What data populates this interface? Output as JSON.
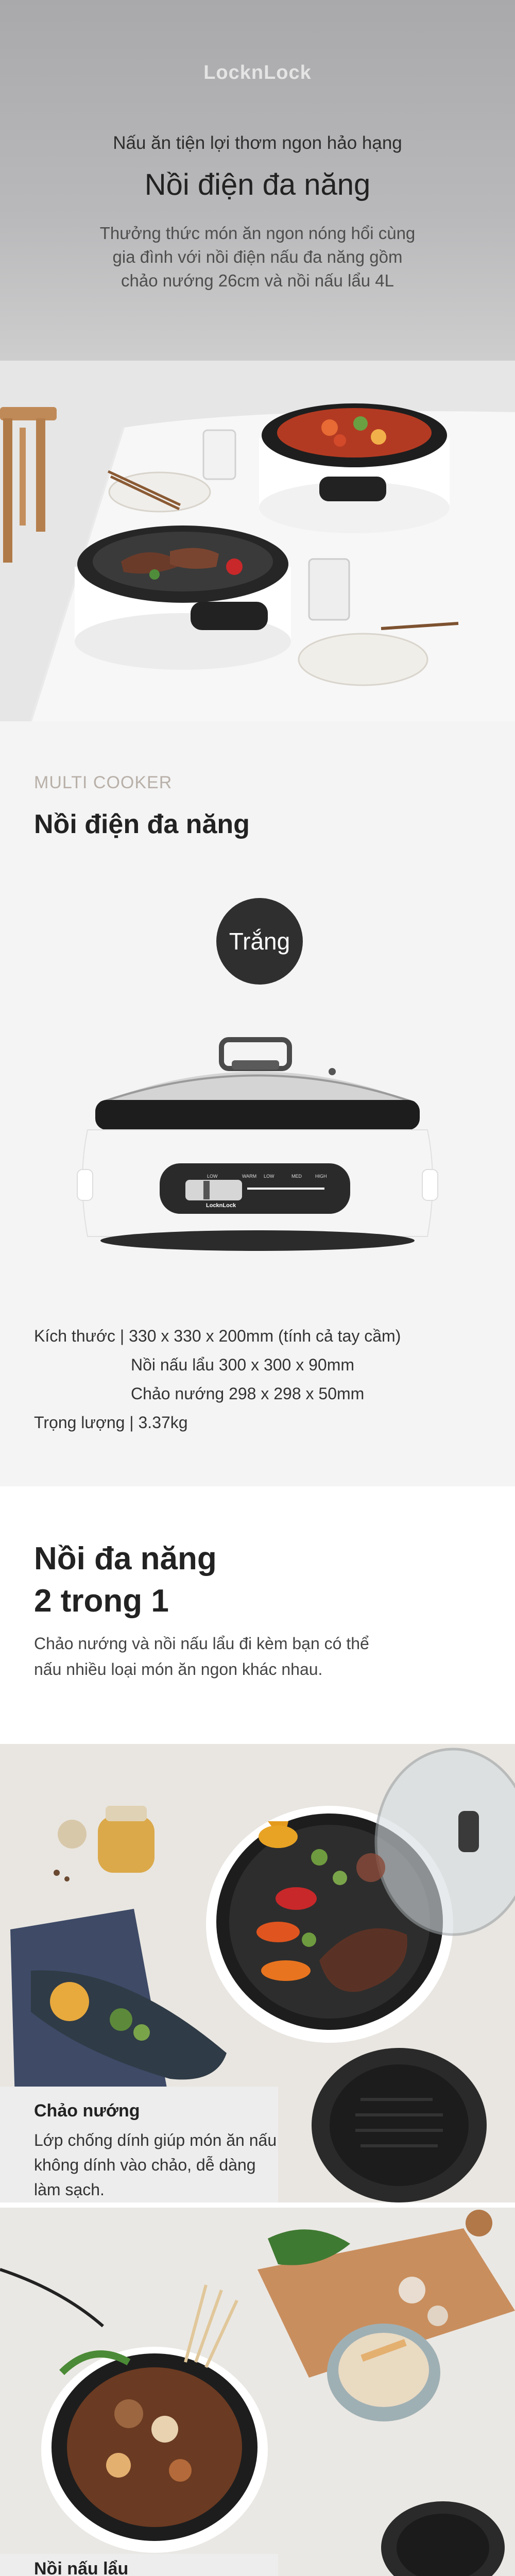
{
  "hero": {
    "brand": "LocknLock",
    "subtitle": "Nấu ăn tiện lợi thơm ngon hảo hạng",
    "title": "Nồi điện đa năng",
    "description_lines": [
      "Thưởng thức món ăn ngon nóng hổi cùng",
      "gia đình với nồi điện nấu đa năng gồm",
      "chảo nướng 26cm và nồi nấu lẩu 4L"
    ]
  },
  "spec": {
    "eyebrow": "MULTI COOKER",
    "title": "Nồi điện đa năng",
    "color_badge": "Trắng",
    "product_brand": "LocknLock",
    "panel_labels": [
      "LOW",
      "WARM",
      "LOW",
      "MED",
      "HIGH"
    ],
    "lines": [
      {
        "text": "Kích thước  |  330 x 330 x 200mm (tính cả  tay cầm)",
        "indent": false
      },
      {
        "text": "Nồi nấu lẩu   300 x 300 x 90mm",
        "indent": true
      },
      {
        "text": "Chảo nướng   298 x 298 x 50mm",
        "indent": true
      },
      {
        "text": "Trọng lượng  |  3.37kg",
        "indent": false
      }
    ]
  },
  "twoin1": {
    "title_line1": "Nồi đa năng",
    "title_line2": "2 trong 1",
    "desc_line1": "Chảo nướng và nồi nấu lẩu đi kèm bạn có thể",
    "desc_line2": "nấu nhiều loại món ăn ngon khác nhau."
  },
  "grill": {
    "caption_title": "Chảo nướng",
    "caption_line1": "Lớp chống dính giúp món ăn nấu",
    "caption_line2": "không dính vào chảo, dễ dàng làm sạch."
  },
  "hotpot": {
    "caption_title": "Nồi nấu lẩu"
  },
  "colors": {
    "hero_bg_top": "#a9a9ab",
    "spec_bg": "#f4f4f4",
    "badge_bg": "#2f2f2f",
    "eyebrow": "#b8b0a8"
  }
}
